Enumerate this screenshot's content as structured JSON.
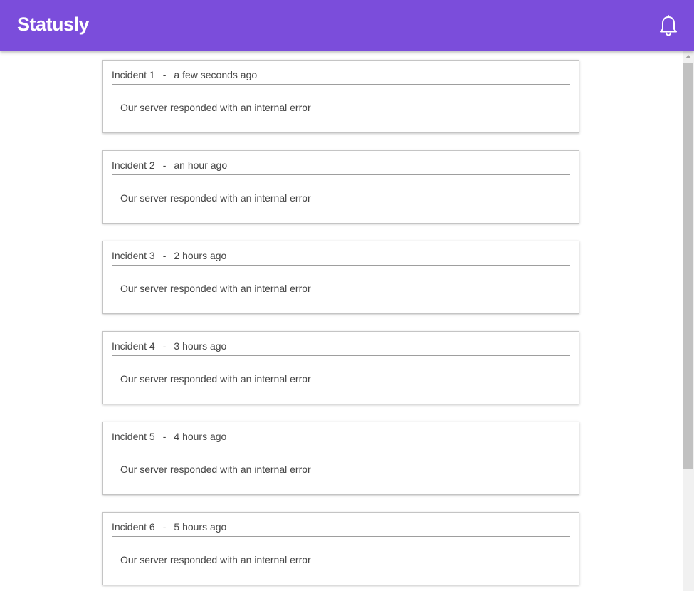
{
  "app": {
    "title": "Statusly"
  },
  "header": {
    "icon": "bell-icon"
  },
  "separator": "-",
  "incidents": [
    {
      "title": "Incident 1",
      "time": "a few seconds ago",
      "message": "Our server responded with an internal error"
    },
    {
      "title": "Incident 2",
      "time": "an hour ago",
      "message": "Our server responded with an internal error"
    },
    {
      "title": "Incident 3",
      "time": "2 hours ago",
      "message": "Our server responded with an internal error"
    },
    {
      "title": "Incident 4",
      "time": "3 hours ago",
      "message": "Our server responded with an internal error"
    },
    {
      "title": "Incident 5",
      "time": "4 hours ago",
      "message": "Our server responded with an internal error"
    },
    {
      "title": "Incident 6",
      "time": "5 hours ago",
      "message": "Our server responded with an internal error"
    }
  ],
  "colors": {
    "accent": "#7b4ddb",
    "text": "#444444",
    "card_border": "#c4c4c4"
  }
}
